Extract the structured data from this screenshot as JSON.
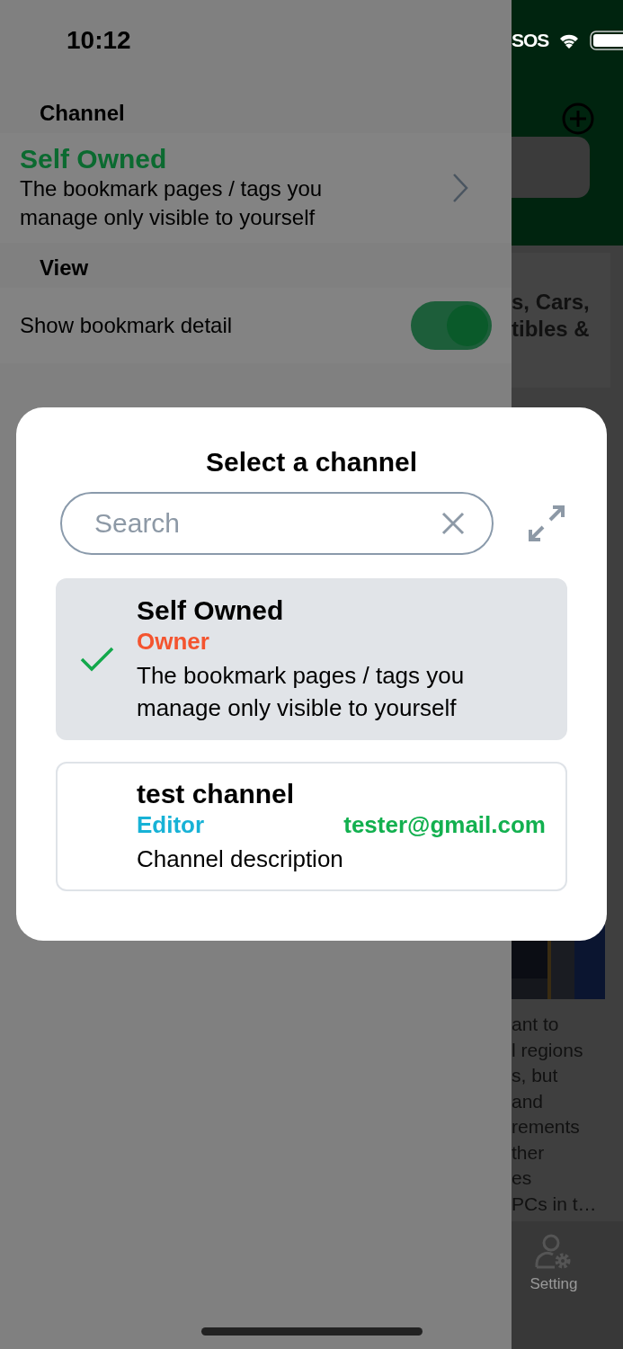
{
  "status_bar": {
    "time": "10:12",
    "signal_text": "SOS"
  },
  "drawer": {
    "channel_header": "Channel",
    "channel": {
      "name": "Self Owned",
      "description": "The bookmark pages / tags you manage only visible to yourself"
    },
    "view_header": "View",
    "settings": [
      {
        "kind": "toggle",
        "label": "Show bookmark detail",
        "on": true
      }
    ]
  },
  "background": {
    "card_lines": [
      "s, Cars,",
      "tibles &"
    ],
    "article_lines": [
      "ant to",
      "l regions",
      "s, but",
      "and",
      "rements",
      "ther",
      "es",
      "PCs in t…"
    ],
    "tab": {
      "label": "Setting"
    }
  },
  "dialog": {
    "title": "Select a channel",
    "search": {
      "placeholder": "Search"
    },
    "channels": [
      {
        "name": "Self Owned",
        "role": "Owner",
        "color": "#f4542f",
        "description": "The bookmark pages / tags you manage only visible to yourself",
        "selected": true
      },
      {
        "name": "test channel",
        "role": "Editor",
        "color": "#17b2d6",
        "email": "tester@gmail.com",
        "description": "Channel description",
        "selected": false
      }
    ]
  }
}
